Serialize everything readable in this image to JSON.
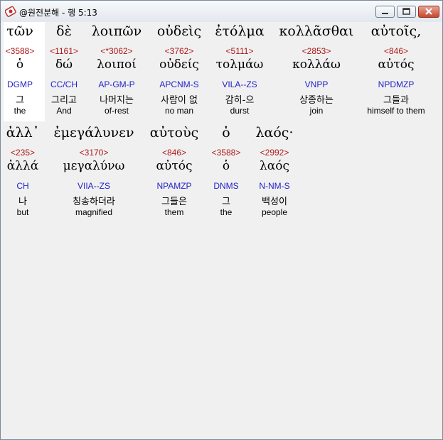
{
  "window": {
    "title": "@원전분해 - 행 5:13",
    "buttons": {
      "minimize": "minimize",
      "maximize": "maximize",
      "close": "close"
    }
  },
  "rows": [
    {
      "words": [
        {
          "greek": "τῶν",
          "strong": "<3588>",
          "lemma": "ὁ",
          "parse": "DGMP",
          "korean": "그",
          "english": "the"
        },
        {
          "greek": "δὲ",
          "strong": "<1161>",
          "lemma": "δώ",
          "parse": "CC/CH",
          "korean": "그리고",
          "english": "And"
        },
        {
          "greek": "λοιπῶν",
          "strong": "<*3062>",
          "lemma": "λοιποί",
          "parse": "AP-GM-P",
          "korean": "나머지는",
          "english": "of-rest"
        },
        {
          "greek": "οὐδεὶς",
          "strong": "<3762>",
          "lemma": "οὐδείς",
          "parse": "APCNM-S",
          "korean": "사람이 없",
          "english": "no man"
        },
        {
          "greek": "ἐτόλμα",
          "strong": "<5111>",
          "lemma": "τολμάω",
          "parse": "VILA--ZS",
          "korean": "감히-으",
          "english": "durst"
        },
        {
          "greek": "κολλᾶσθαι",
          "strong": "<2853>",
          "lemma": "κολλάω",
          "parse": "VNPP",
          "korean": "상종하는",
          "english": "join"
        },
        {
          "greek": "αὐτοῖς,",
          "strong": "<846>",
          "lemma": "αὐτός",
          "parse": "NPDMZP",
          "korean": "그들과",
          "english": "himself to them"
        }
      ]
    },
    {
      "words": [
        {
          "greek": "ἀλλ᾽",
          "strong": "<235>",
          "lemma": "ἀλλά",
          "parse": "CH",
          "korean": "나",
          "english": "but"
        },
        {
          "greek": "ἐμεγάλυνεν",
          "strong": "<3170>",
          "lemma": "μεγαλύνω",
          "parse": "VIIA--ZS",
          "korean": "칭송하더라",
          "english": "magnified"
        },
        {
          "greek": "αὐτοὺς",
          "strong": "<846>",
          "lemma": "αὐτός",
          "parse": "NPAMZP",
          "korean": "그들은",
          "english": "them"
        },
        {
          "greek": "ὁ",
          "strong": "<3588>",
          "lemma": "ὁ",
          "parse": "DNMS",
          "korean": "그",
          "english": "the"
        },
        {
          "greek": "λαός·",
          "strong": "<2992>",
          "lemma": "λαός",
          "parse": "N-NM-S",
          "korean": "백성이",
          "english": "people"
        }
      ]
    }
  ]
}
